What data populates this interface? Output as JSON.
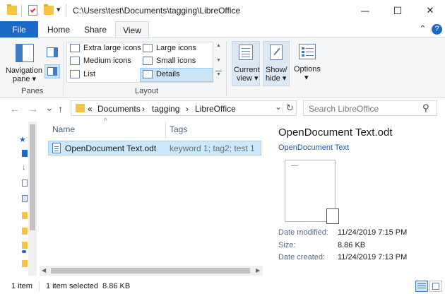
{
  "window": {
    "path": "C:\\Users\\test\\Documents\\tagging\\LibreOffice",
    "minimize_glyph": "—",
    "maximize_glyph": "☐",
    "close_glyph": "✕",
    "quick_access_dropdown_glyph": "▾"
  },
  "tabs": [
    {
      "label": "File"
    },
    {
      "label": "Home"
    },
    {
      "label": "Share"
    },
    {
      "label": "View"
    }
  ],
  "ribbon_right": {
    "collapse_glyph": "⌃",
    "help_glyph": "?"
  },
  "ribbon": {
    "panes_group": {
      "label": "Panes",
      "navigation_pane_label_1": "Navigation",
      "navigation_pane_label_2": "pane ▾"
    },
    "layout_group": {
      "label": "Layout",
      "options": [
        {
          "label": "Extra large icons"
        },
        {
          "label": "Large icons"
        },
        {
          "label": "Medium icons"
        },
        {
          "label": "Small icons"
        },
        {
          "label": "List"
        },
        {
          "label": "Details",
          "selected": true
        }
      ],
      "scroll_up": "▲",
      "scroll_down": "▼"
    },
    "current_view": {
      "label_1": "Current",
      "label_2": "view ▾"
    },
    "show_hide": {
      "label_1": "Show/",
      "label_2": "hide ▾"
    },
    "options": {
      "label": "Options",
      "dropdown": "▾"
    }
  },
  "navigation": {
    "back": "←",
    "forward": "→",
    "recent": "⌄",
    "up": "↑",
    "breadcrumb_overflow": "«",
    "breadcrumbs": [
      "Documents",
      "tagging",
      "LibreOffice"
    ],
    "separator": "›",
    "address_dropdown": "⌄",
    "refresh": "↻",
    "search_placeholder": "Search LibreOffice",
    "search_glyph": "⚲"
  },
  "file_list": {
    "sort_indicator": "^",
    "columns": [
      {
        "label": "Name"
      },
      {
        "label": "Tags"
      }
    ],
    "rows": [
      {
        "name": "OpenDocument Text.odt",
        "tags": "keyword 1; tag2; test 1",
        "selected": true
      }
    ],
    "scroll_left": "◀",
    "scroll_right": "▶"
  },
  "preview": {
    "title": "OpenDocument Text.odt",
    "type": "OpenDocument Text",
    "metadata": [
      {
        "key": "Date modified:",
        "value": "11/24/2019 7:15 PM"
      },
      {
        "key": "Size:",
        "value": "8.86 KB"
      },
      {
        "key": "Date created:",
        "value": "11/24/2019 7:13 PM"
      }
    ]
  },
  "status_bar": {
    "item_count": "1 item",
    "selection": "1 item selected  8.86 KB"
  },
  "colors": {
    "accent": "#1a68c8",
    "selection": "#cce8ff",
    "folder": "#f4c542"
  }
}
